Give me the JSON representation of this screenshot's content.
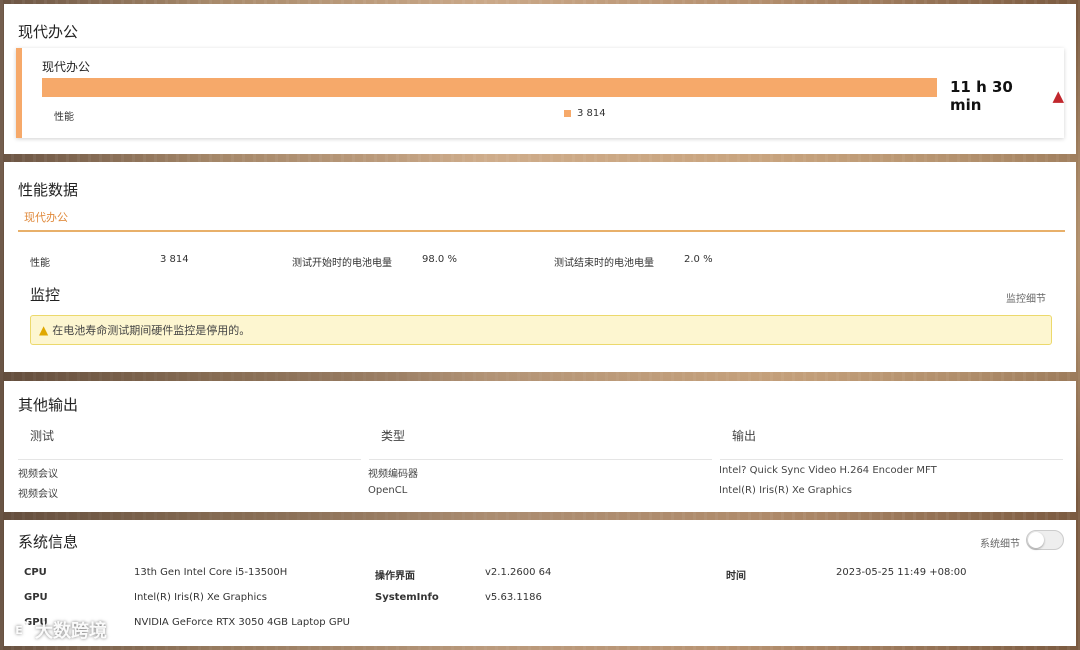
{
  "battery_panel": {
    "title": "现代办公",
    "test_name": "现代办公",
    "duration": "11 h 30 min",
    "bar_fill_fraction": 1.0,
    "perf_label": "性能",
    "perf_value": "3 814",
    "bar_color": "#f6a96a"
  },
  "perf_panel": {
    "title": "性能数据",
    "tab": "现代办公",
    "metrics": [
      {
        "label": "性能",
        "value": "3 814"
      },
      {
        "label": "测试开始时的电池电量",
        "value": "98.0 %"
      },
      {
        "label": "测试结束时的电池电量",
        "value": "2.0 %"
      }
    ],
    "monitor_title": "监控",
    "monitor_link": "监控细节",
    "alert": "在电池寿命测试期间硬件监控是停用的。"
  },
  "output_panel": {
    "title": "其他输出",
    "headers": [
      "测试",
      "类型",
      "输出"
    ],
    "rows": [
      [
        "视频会议",
        "视频编码器",
        "Intel? Quick Sync Video H.264 Encoder MFT"
      ],
      [
        "视频会议",
        "OpenCL",
        "Intel(R) Iris(R) Xe Graphics"
      ]
    ]
  },
  "sys_panel": {
    "title": "系统信息",
    "details_label": "系统细节",
    "details_on": false,
    "items": [
      {
        "key": "CPU",
        "value": "13th Gen Intel Core i5-13500H"
      },
      {
        "key": "操作界面",
        "value": "v2.1.2600 64"
      },
      {
        "key": "时间",
        "value": "2023-05-25 11:49 +08:00"
      },
      {
        "key": "GPU",
        "value": "Intel(R) Iris(R) Xe Graphics"
      },
      {
        "key": "SystemInfo",
        "value": "v5.63.1186"
      },
      {
        "key": "GPU",
        "value": "NVIDIA GeForce RTX 3050 4GB Laptop GPU"
      }
    ]
  },
  "watermark": {
    "logo_text": "E",
    "text": "大数跨境"
  }
}
